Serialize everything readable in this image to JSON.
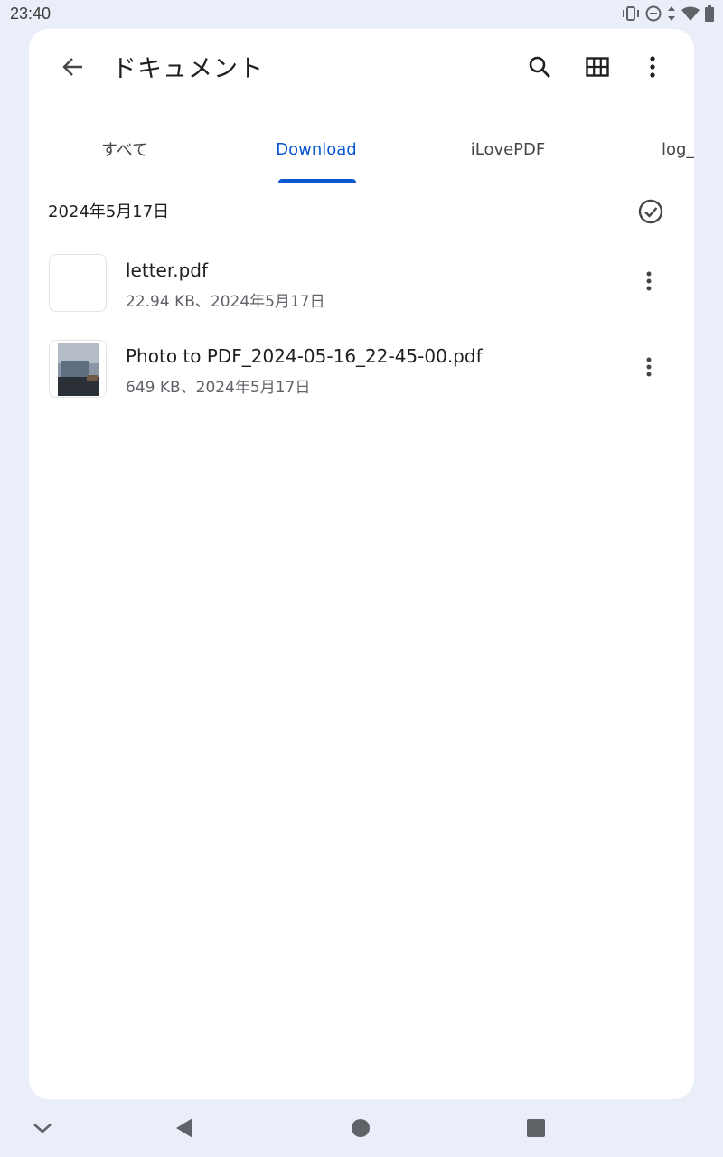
{
  "status_bar": {
    "time": "23:40",
    "icons": [
      "vibrate-icon",
      "dnd-icon",
      "data-arrows-icon",
      "wifi-icon",
      "battery-icon"
    ]
  },
  "app_bar": {
    "title": "ドキュメント",
    "icons": [
      "back-arrow-icon",
      "search-icon",
      "grid-view-icon",
      "more-vert-icon"
    ]
  },
  "tabs": [
    {
      "label": "すべて",
      "active": false
    },
    {
      "label": "Download",
      "active": true
    },
    {
      "label": "iLovePDF",
      "active": false
    },
    {
      "label": "log_",
      "active": false
    }
  ],
  "section": {
    "date": "2024年5月17日",
    "select_icon": "check-circle-icon"
  },
  "files": [
    {
      "name": "letter.pdf",
      "meta": "22.94 KB、2024年5月17日",
      "thumbnail": "blank"
    },
    {
      "name": "Photo to PDF_2024-05-16_22-45-00.pdf",
      "meta": "649 KB、2024年5月17日",
      "thumbnail": "photo"
    }
  ],
  "nav_bar": {
    "icons": [
      "collapse-icon",
      "back-triangle-icon",
      "home-circle-icon",
      "recents-square-icon"
    ]
  },
  "colors": {
    "background": "#e9eef8",
    "surface": "#ffffff",
    "accent": "#0b57d0",
    "text_primary": "#1f1f1f",
    "text_secondary": "#5f6368"
  }
}
